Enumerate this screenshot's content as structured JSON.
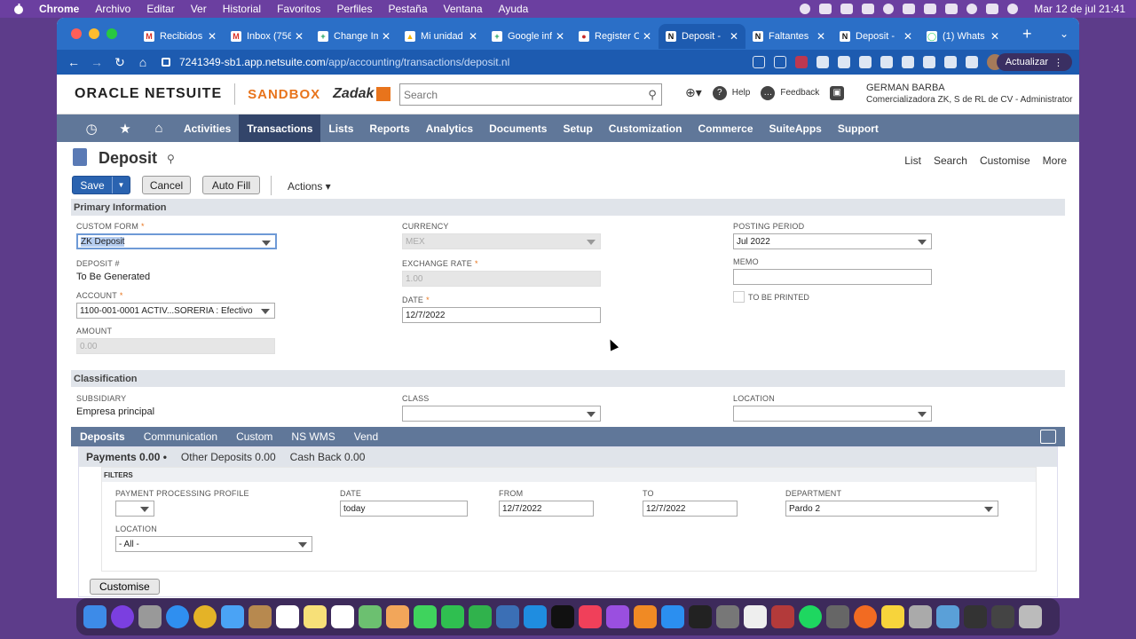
{
  "menubar": {
    "app": "Chrome",
    "items": [
      "Archivo",
      "Editar",
      "Ver",
      "Historial",
      "Favoritos",
      "Perfiles",
      "Pestaña",
      "Ventana",
      "Ayuda"
    ],
    "clock": "Mar 12 de jul  21:41"
  },
  "tabs": [
    {
      "title": "Recibidos",
      "icon": "gmail-icon",
      "color": "#d93025",
      "glyph": "M"
    },
    {
      "title": "Inbox (756",
      "icon": "gmail-icon",
      "color": "#d93025",
      "glyph": "M"
    },
    {
      "title": "Change Im",
      "icon": "sheets-icon",
      "color": "#0f9d58",
      "glyph": "+"
    },
    {
      "title": "Mi unidad",
      "icon": "drive-icon",
      "color": "#f4b400",
      "glyph": "▲"
    },
    {
      "title": "Google inf",
      "icon": "sheets-icon",
      "color": "#0f9d58",
      "glyph": "+"
    },
    {
      "title": "Register C",
      "icon": "drop-icon",
      "color": "#c62828",
      "glyph": "●"
    },
    {
      "title": "Deposit -",
      "icon": "netsuite-icon",
      "color": "#111111",
      "glyph": "N",
      "active": true
    },
    {
      "title": "Faltantes",
      "icon": "netsuite-icon",
      "color": "#111111",
      "glyph": "N"
    },
    {
      "title": "Deposit -",
      "icon": "netsuite-icon",
      "color": "#111111",
      "glyph": "N"
    },
    {
      "title": "(1) Whats",
      "icon": "whatsapp-icon",
      "color": "#25d366",
      "glyph": "◯"
    }
  ],
  "address": {
    "host": "7241349-sb1.app.netsuite.com",
    "path": "/app/accounting/transactions/deposit.nl"
  },
  "update_label": "Actualizar",
  "header": {
    "oracle": "ORACLE NETSUITE",
    "sandbox": "SANDBOX",
    "brand": "Zadak",
    "search_placeholder": "Search",
    "help": "Help",
    "feedback": "Feedback",
    "user_name": "GERMAN BARBA",
    "user_role": "Comercializadora ZK, S de RL de CV - Administrator"
  },
  "nav": [
    "Activities",
    "Transactions",
    "Lists",
    "Reports",
    "Analytics",
    "Documents",
    "Setup",
    "Customization",
    "Commerce",
    "SuiteApps",
    "Support"
  ],
  "page": {
    "title": "Deposit",
    "links": [
      "List",
      "Search",
      "Customise",
      "More"
    ],
    "save": "Save",
    "cancel": "Cancel",
    "autofill": "Auto Fill",
    "actions": "Actions ▾"
  },
  "primary": {
    "heading": "Primary Information",
    "custom_form_label": "CUSTOM FORM",
    "custom_form": "ZK Deposit",
    "deposit_no_label": "DEPOSIT #",
    "deposit_no": "To Be Generated",
    "account_label": "ACCOUNT",
    "account": "1100-001-0001 ACTIV...SORERIA : Efectivo",
    "amount_label": "AMOUNT",
    "amount": "0.00",
    "currency_label": "CURRENCY",
    "currency": "MEX",
    "exchange_label": "EXCHANGE RATE",
    "exchange": "1.00",
    "date_label": "DATE",
    "date": "12/7/2022",
    "posting_label": "POSTING PERIOD",
    "posting": "Jul 2022",
    "memo_label": "MEMO",
    "memo": "",
    "printed_label": "TO BE PRINTED"
  },
  "classification": {
    "heading": "Classification",
    "subsidiary_label": "SUBSIDIARY",
    "subsidiary": "Empresa principal",
    "class_label": "CLASS",
    "class": "",
    "location_label": "LOCATION",
    "location": ""
  },
  "subtabs": [
    "Deposits",
    "Communication",
    "Custom",
    "NS WMS",
    "Vend"
  ],
  "deposit_tabs": [
    "Payments 0.00 •",
    "Other Deposits 0.00",
    "Cash Back 0.00"
  ],
  "filters": {
    "heading": "FILTERS",
    "profile_label": "PAYMENT PROCESSING PROFILE",
    "date_label": "DATE",
    "date": "today",
    "from_label": "FROM",
    "from": "12/7/2022",
    "to_label": "TO",
    "to": "12/7/2022",
    "department_label": "DEPARTMENT",
    "department": "Pardo 2",
    "location_label": "LOCATION",
    "location": "- All -"
  },
  "customise_btn": "Customise"
}
